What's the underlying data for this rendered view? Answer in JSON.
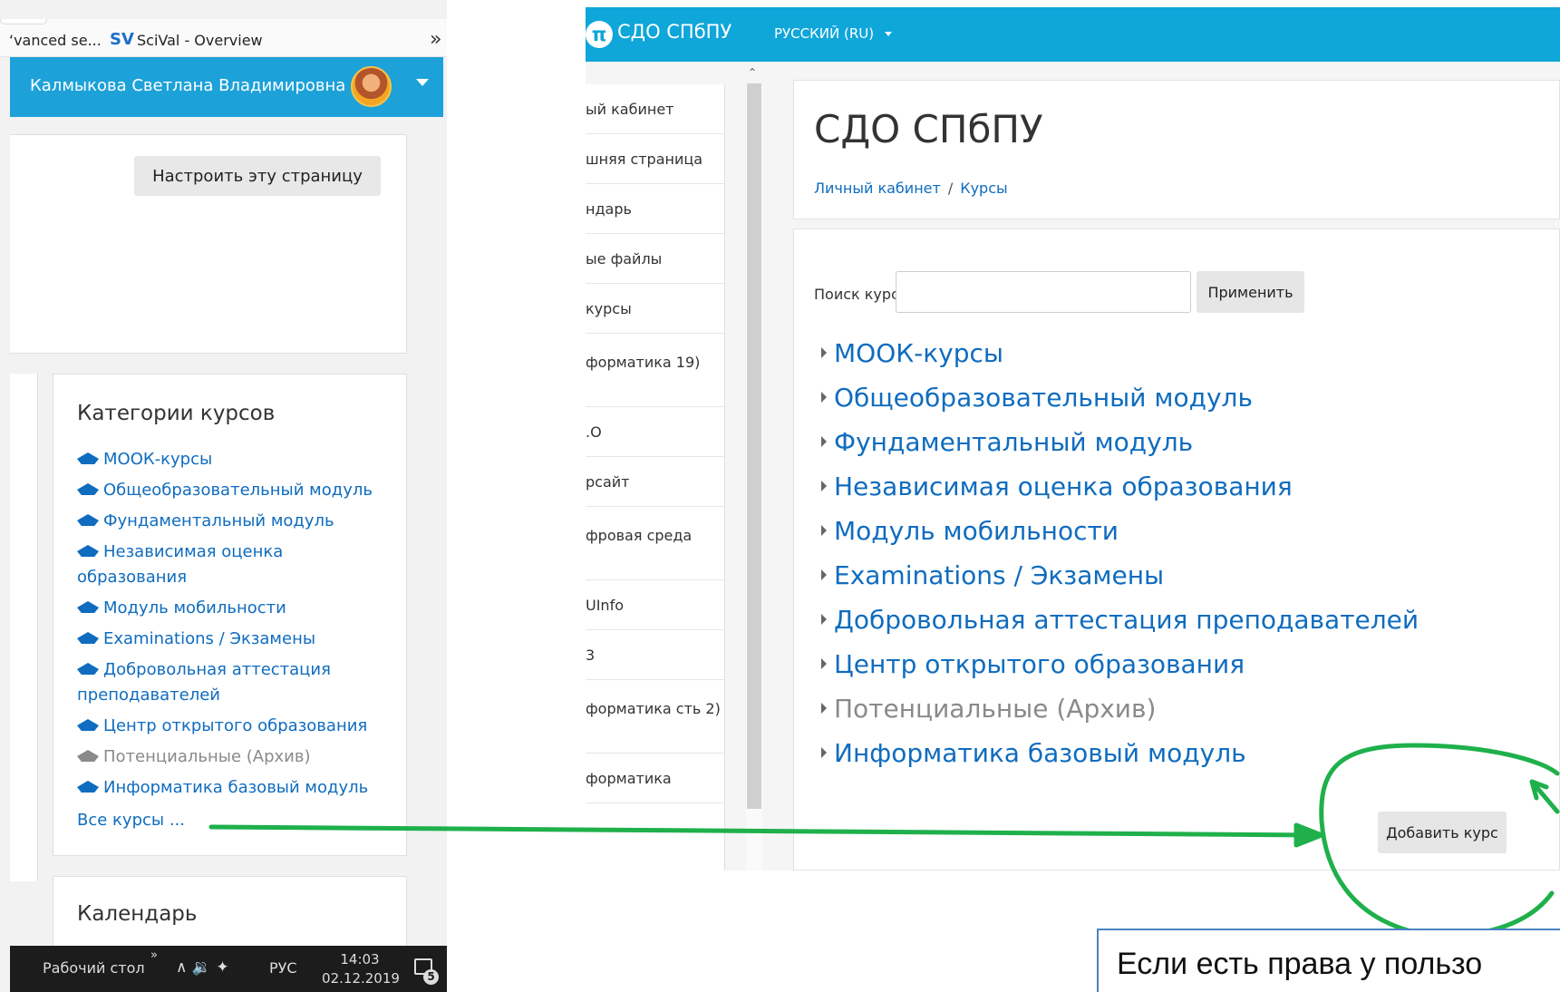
{
  "bookmarks": {
    "item1": "‘vanced se...",
    "sv_badge": "SV",
    "item2": "SciVal - Overview",
    "more": "»"
  },
  "user": {
    "name": "Калмыкова Светлана Владимировна"
  },
  "left_page": {
    "customize_button": "Настроить эту страницу",
    "categories": {
      "title": "Категории курсов",
      "items": [
        "МООК-курсы",
        "Общеобразовательный модуль",
        "Фундаментальный модуль",
        "Независимая оценка образования",
        "Модуль мобильности",
        "Examinations / Экзамены",
        "Добровольная аттестация преподавателей",
        "Центр открытого образования",
        "Потенциальные (Архив)",
        "Информатика базовый модуль"
      ],
      "all_courses": "Все курсы ..."
    },
    "calendar_title": "Календарь"
  },
  "taskbar": {
    "desktop": "Рабочий стол",
    "chevron": "»",
    "tray": "∧ 🔉 ✦",
    "language": "РУС",
    "time": "14:03",
    "date": "02.12.2019",
    "notification_count": "5"
  },
  "right_page": {
    "logo_glyph": "π",
    "brand": "СДО СПбПУ",
    "language_menu": "РУССКИЙ (RU)",
    "drawer": [
      "ый кабинет",
      "шняя страница",
      "ндарь",
      "ые файлы",
      "курсы",
      "форматика 19)",
      ".О",
      "рсайт",
      "фровая среда",
      "UInfo",
      "3",
      "форматика сть 2)",
      "форматика"
    ],
    "page_title": "СДО СПбПУ",
    "breadcrumb": {
      "home": "Личный кабинет",
      "separator": "/",
      "current": "Курсы"
    },
    "search": {
      "label": "Поиск курса",
      "value": "",
      "apply_button": "Применить"
    },
    "courses": [
      "МООК-курсы",
      "Общеобразовательный модуль",
      "Фундаментальный модуль",
      "Независимая оценка образования",
      "Модуль мобильности",
      "Examinations / Экзамены",
      "Добровольная аттестация преподавателей",
      "Центр открытого образования",
      "Потенциальные (Архив)",
      "Информатика базовый модуль"
    ],
    "add_course_button": "Добавить курс"
  },
  "callout": {
    "text": "Если есть права у пользо"
  },
  "colors": {
    "moodle_blue": "#0fa6d9",
    "link": "#0f6cbf",
    "annotation_green": "#1fb04b",
    "callout_border": "#4a82c4"
  }
}
